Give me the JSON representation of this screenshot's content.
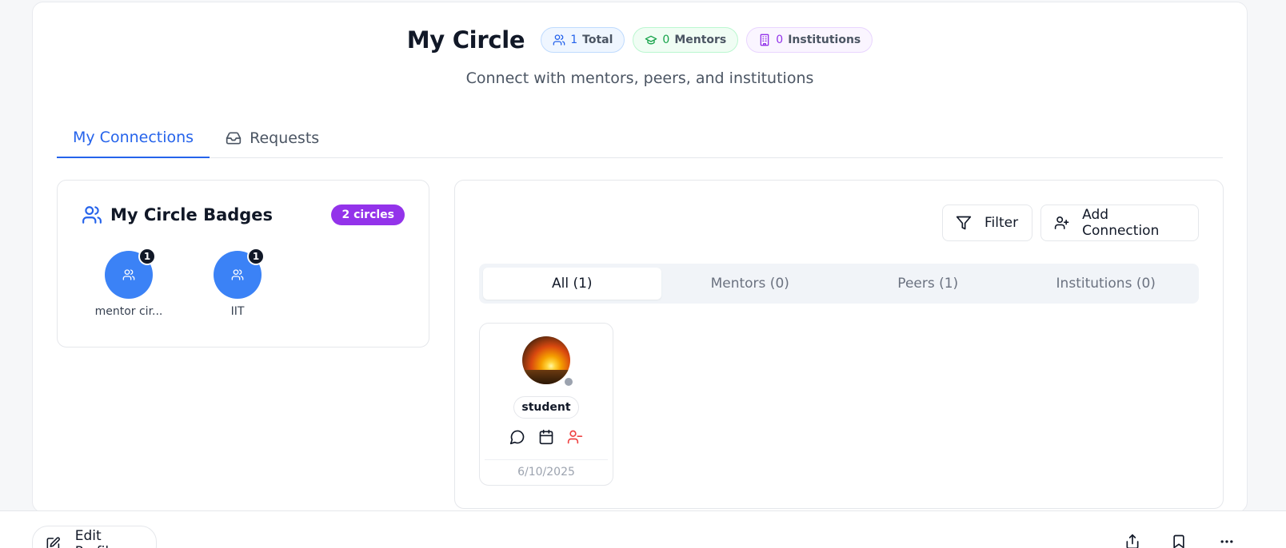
{
  "header": {
    "title": "My Circle",
    "subtitle": "Connect with mentors, peers, and institutions",
    "stats": {
      "total": {
        "count": "1",
        "label": "Total"
      },
      "mentors": {
        "count": "0",
        "label": "Mentors"
      },
      "institutions": {
        "count": "0",
        "label": "Institutions"
      }
    }
  },
  "tabs": {
    "connections": "My Connections",
    "requests": "Requests"
  },
  "badges": {
    "title": "My Circle Badges",
    "count_label": "2 circles",
    "circles": [
      {
        "name": "mentor cir...",
        "count": "1"
      },
      {
        "name": "IIT",
        "count": "1"
      }
    ]
  },
  "toolbar": {
    "filter_label": "Filter",
    "add_label": "Add Connection"
  },
  "segments": [
    "All (1)",
    "Mentors (0)",
    "Peers (1)",
    "Institutions (0)"
  ],
  "connection": {
    "role": "student",
    "date": "6/10/2025"
  },
  "footer": {
    "edit_label": "Edit Profile"
  },
  "colors": {
    "accent": "#2563eb",
    "badge_purple": "#9333ea",
    "circle_blue": "#3b82f6",
    "remove_red": "#ef4444"
  }
}
